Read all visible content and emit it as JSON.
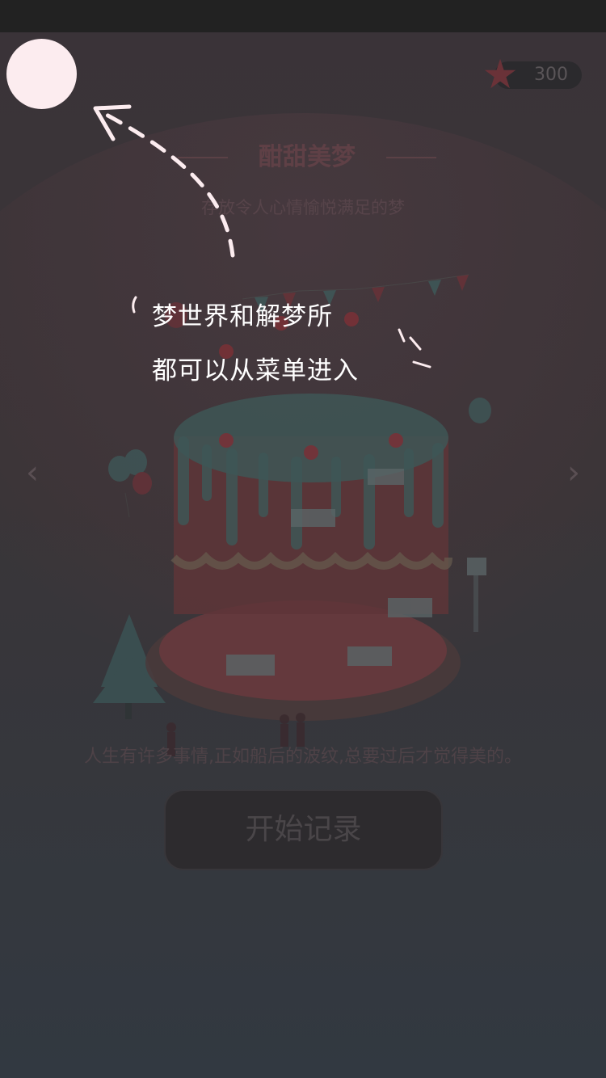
{
  "coins": {
    "value": "300",
    "icon": "star-icon",
    "star_color": "#6a3238"
  },
  "header": {
    "title": "酣甜美梦",
    "subtitle": "存放令人心情愉悦满足的梦"
  },
  "navigation": {
    "prev_icon": "chevron-left-icon",
    "next_icon": "chevron-right-icon"
  },
  "quote": "人生有许多事情,正如船后的波纹,总要过后才觉得美的。",
  "start_button": {
    "label": "开始记录"
  },
  "guide": {
    "line1": "梦世界和解梦所",
    "line2": "都可以从菜单进入"
  }
}
